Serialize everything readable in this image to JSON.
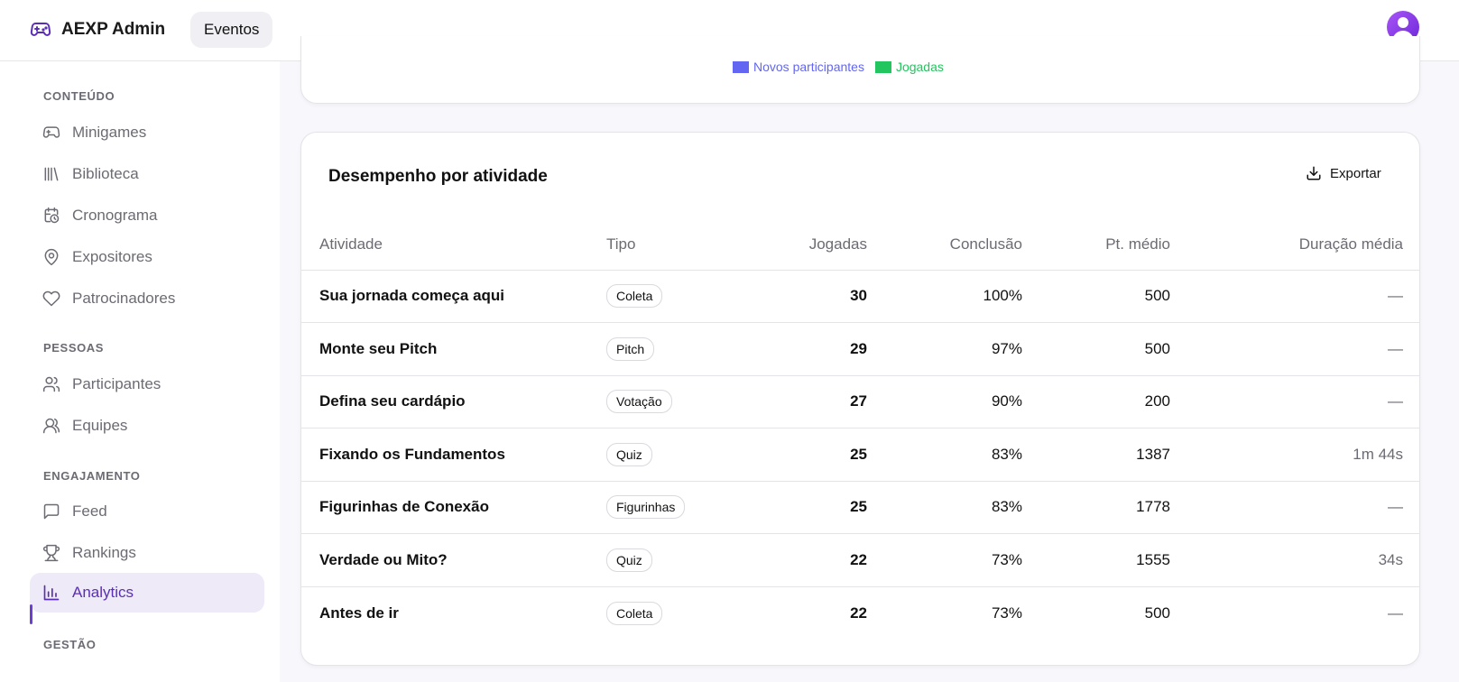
{
  "header": {
    "app_title": "AEXP Admin",
    "nav_item": "Eventos"
  },
  "sidebar": {
    "sections": [
      {
        "label": "CONTEÚDO",
        "items": [
          {
            "label": "Minigames",
            "icon": "gamepad-icon"
          },
          {
            "label": "Biblioteca",
            "icon": "library-icon"
          },
          {
            "label": "Cronograma",
            "icon": "calendar-clock-icon"
          },
          {
            "label": "Expositores",
            "icon": "map-pin-icon"
          },
          {
            "label": "Patrocinadores",
            "icon": "heart-icon"
          }
        ]
      },
      {
        "label": "PESSOAS",
        "items": [
          {
            "label": "Participantes",
            "icon": "users-icon"
          },
          {
            "label": "Equipes",
            "icon": "team-icon"
          }
        ]
      },
      {
        "label": "ENGAJAMENTO",
        "items": [
          {
            "label": "Feed",
            "icon": "message-square-icon"
          },
          {
            "label": "Rankings",
            "icon": "trophy-icon"
          },
          {
            "label": "Analytics",
            "icon": "bar-chart-icon",
            "active": true
          }
        ]
      },
      {
        "label": "GESTÃO",
        "items": []
      }
    ]
  },
  "chart_legend": [
    {
      "label": "Novos participantes",
      "color": "#6366f1"
    },
    {
      "label": "Jogadas",
      "color": "#22c55e"
    }
  ],
  "performance": {
    "title": "Desempenho por atividade",
    "export_label": "Exportar",
    "columns": [
      "Atividade",
      "Tipo",
      "Jogadas",
      "Conclusão",
      "Pt. médio",
      "Duração média"
    ],
    "rows": [
      {
        "atividade": "Sua jornada começa aqui",
        "tipo": "Coleta",
        "jogadas": "30",
        "conclusao": "100%",
        "pt_medio": "500",
        "duracao": "—"
      },
      {
        "atividade": "Monte seu Pitch",
        "tipo": "Pitch",
        "jogadas": "29",
        "conclusao": "97%",
        "pt_medio": "500",
        "duracao": "—"
      },
      {
        "atividade": "Defina seu cardápio",
        "tipo": "Votação",
        "jogadas": "27",
        "conclusao": "90%",
        "pt_medio": "200",
        "duracao": "—"
      },
      {
        "atividade": "Fixando os Fundamentos",
        "tipo": "Quiz",
        "jogadas": "25",
        "conclusao": "83%",
        "pt_medio": "1387",
        "duracao": "1m 44s"
      },
      {
        "atividade": "Figurinhas de Conexão",
        "tipo": "Figurinhas",
        "jogadas": "25",
        "conclusao": "83%",
        "pt_medio": "1778",
        "duracao": "—"
      },
      {
        "atividade": "Verdade ou Mito?",
        "tipo": "Quiz",
        "jogadas": "22",
        "conclusao": "73%",
        "pt_medio": "1555",
        "duracao": "34s"
      },
      {
        "atividade": "Antes de ir",
        "tipo": "Coleta",
        "jogadas": "22",
        "conclusao": "73%",
        "pt_medio": "500",
        "duracao": "—"
      }
    ]
  }
}
